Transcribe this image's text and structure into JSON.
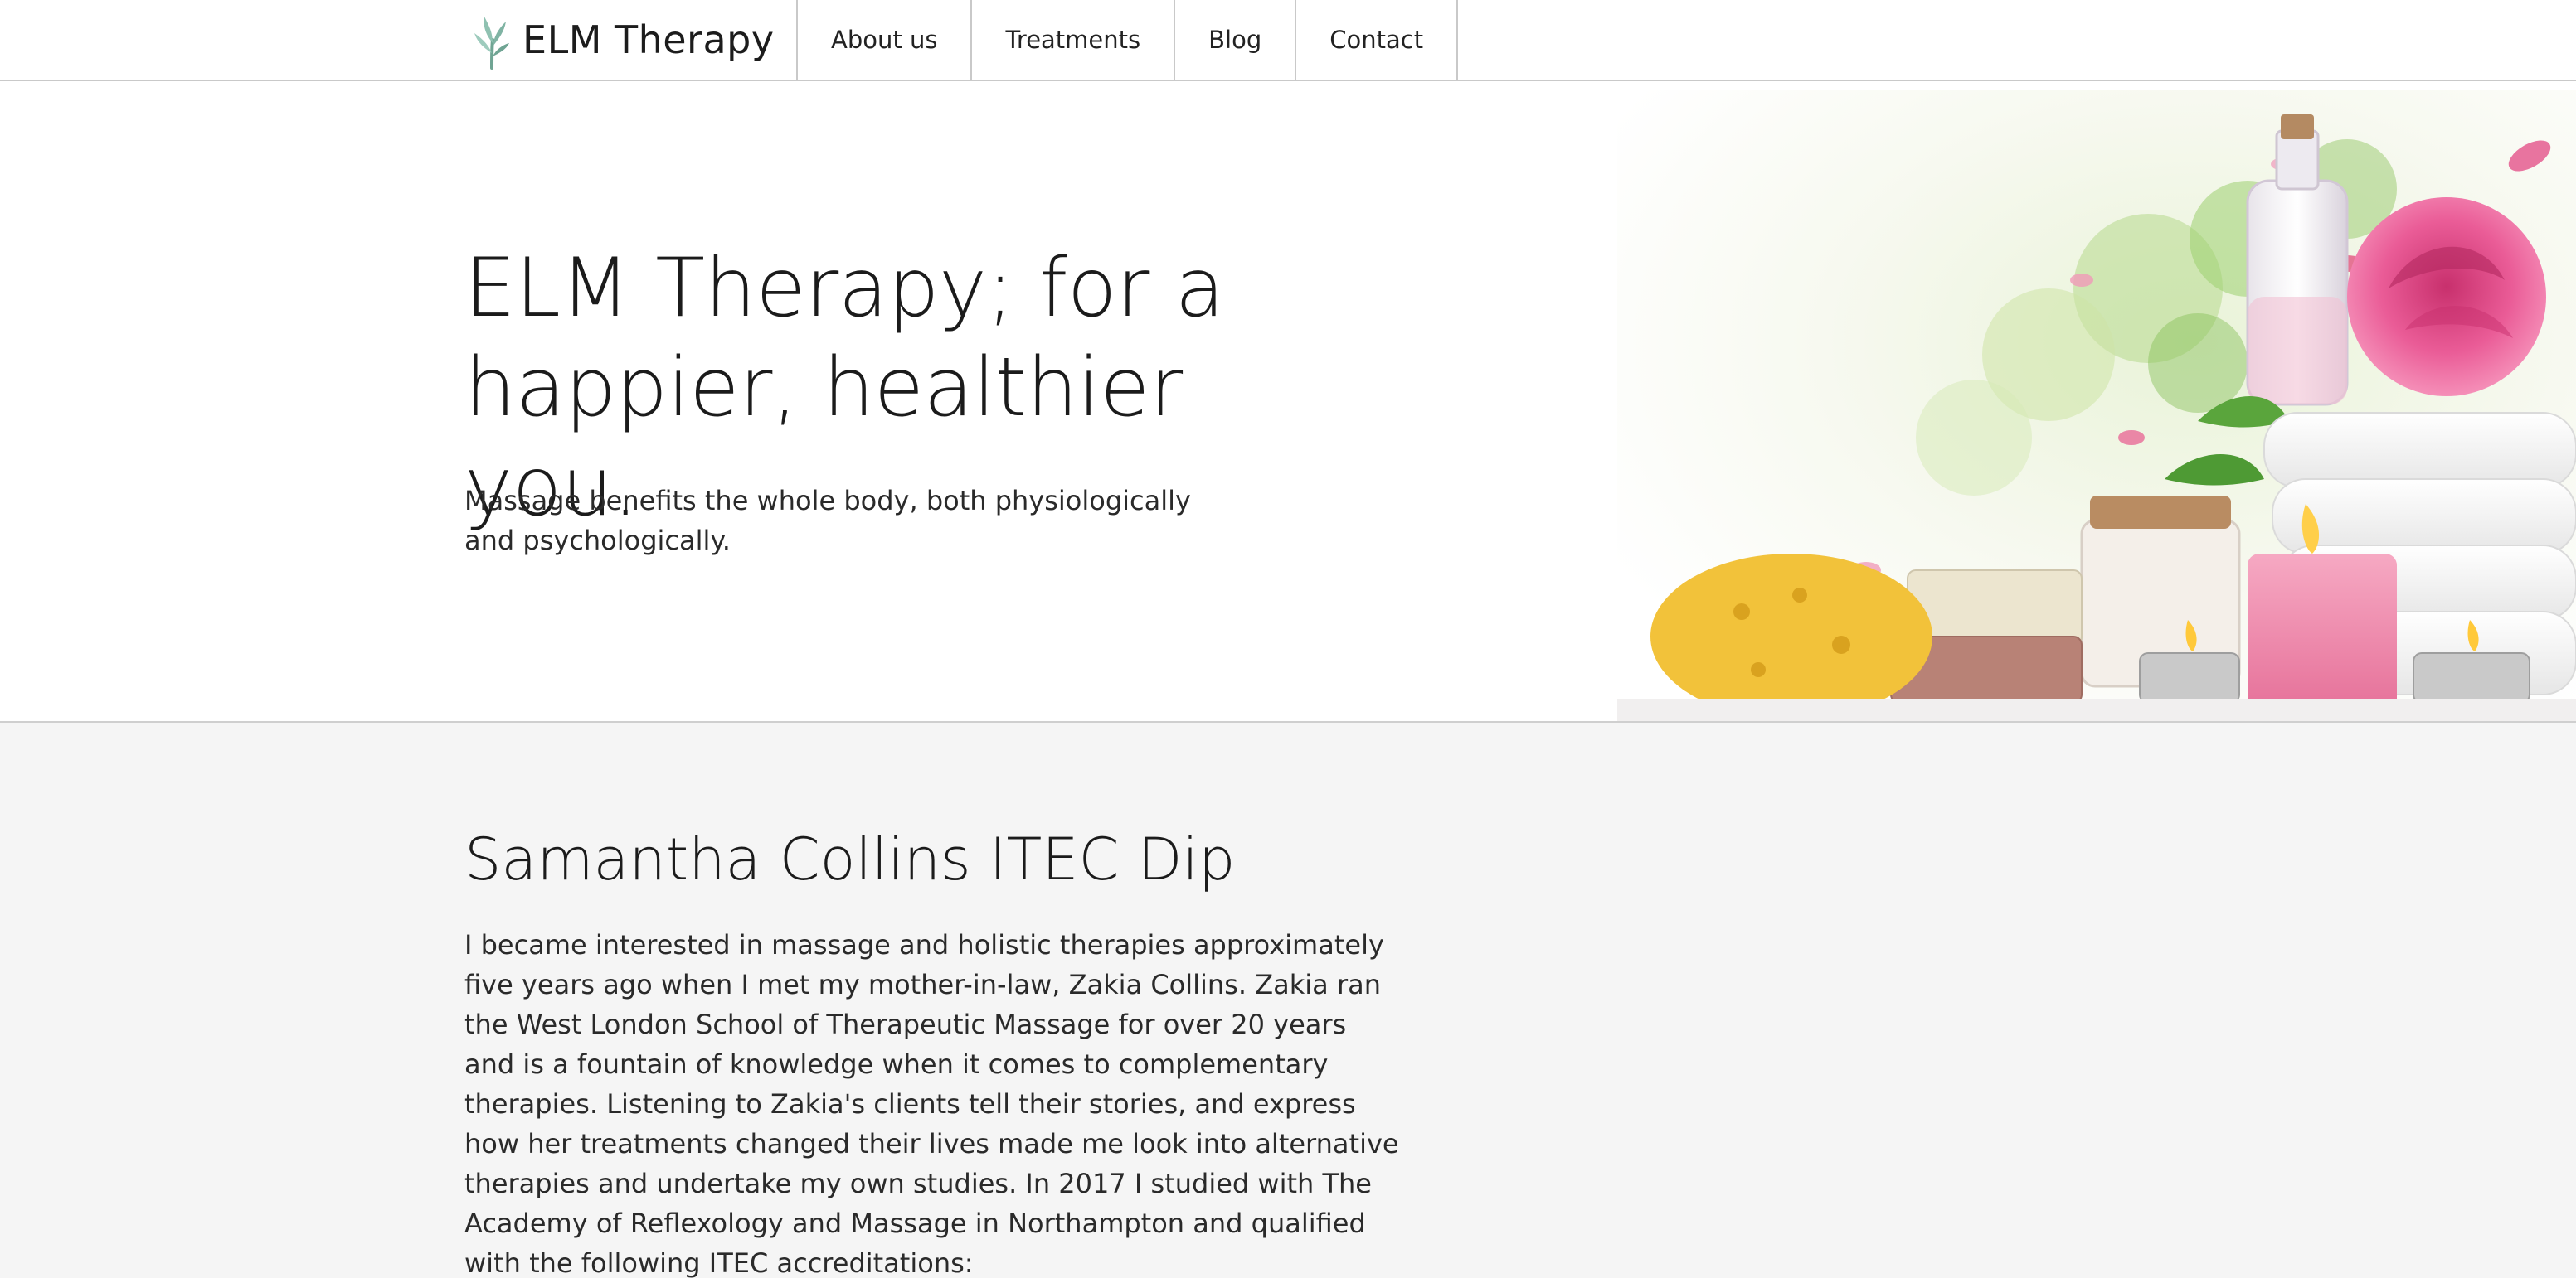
{
  "header": {
    "brand_name": "ELM Therapy",
    "nav": [
      {
        "label": "About us"
      },
      {
        "label": "Treatments"
      },
      {
        "label": "Blog"
      },
      {
        "label": "Contact"
      }
    ]
  },
  "hero": {
    "title": "ELM Therapy; for a happier, healthier you.",
    "subtitle": "Massage benefits the whole body, both physiologically and psychologically."
  },
  "about": {
    "title": "Samantha Collins ITEC Dip",
    "body": "I became interested in massage and holistic therapies approximately five years ago when I met my mother-in-law, Zakia Collins. Zakia ran the West London School of Therapeutic Massage for over 20 years and is a fountain of knowledge when it comes to complementary therapies. Listening to Zakia's clients tell their stories, and express how her treatments changed their lives made me look into alternative therapies and undertake my own studies. In 2017 I studied with The Academy of Reflexology and Massage in Northampton and qualified with the following ITEC accreditations:"
  },
  "colors": {
    "brand_leaf": "#7fb3a3",
    "section_bg": "#f5f5f5",
    "border": "#c9c9c9"
  },
  "icons": {
    "brand": "elm-tree-logo-icon"
  }
}
